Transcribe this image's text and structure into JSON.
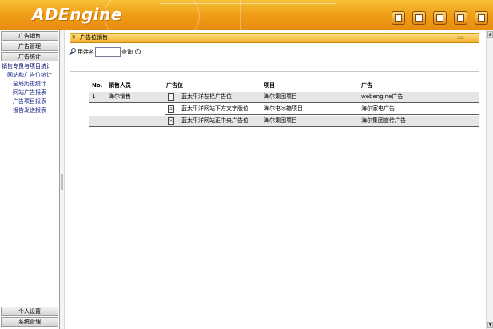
{
  "app": {
    "logo_text": "ADEngine"
  },
  "header_icons": [
    {
      "icon": "tools-icon"
    },
    {
      "icon": "window-icon"
    },
    {
      "icon": "monitor-icon"
    },
    {
      "icon": "edit-icon"
    },
    {
      "icon": "exit-icon"
    }
  ],
  "sidebar": {
    "sections": [
      {
        "label": "广告销售"
      },
      {
        "label": "广告管理"
      },
      {
        "label": "广告统计"
      }
    ],
    "links": [
      {
        "label": "销售专员与项目统计"
      },
      {
        "label": "网站和广告位统计"
      },
      {
        "label": "全局历史统计"
      },
      {
        "label": "网站广告报表"
      },
      {
        "label": "广告项目报表"
      },
      {
        "label": "报告发送报表"
      }
    ],
    "bottom_sections": [
      {
        "label": "个人设置"
      },
      {
        "label": "系统管理"
      }
    ]
  },
  "panel": {
    "title": "广告位销售",
    "dots": "::::::"
  },
  "search": {
    "label": "用姓名",
    "value": "",
    "button_label": "查询"
  },
  "table": {
    "headers": {
      "no": "No.",
      "person": "销售人员",
      "position": "广告位",
      "project": "项目",
      "ad": "广告"
    },
    "rows": [
      {
        "no": "1",
        "person": "海尔销售",
        "position_icon": "document-icon",
        "position": "蓝太平洋左栏广告位",
        "project": "海尔集团项目",
        "ad": "webengine广告"
      },
      {
        "no": "",
        "person": "",
        "position_icon": "text-ad-icon",
        "position": "蓝太平洋网站下方文字版位",
        "project": "海尔电冰箱项目",
        "ad": "海尔家电广告"
      },
      {
        "no": "",
        "person": "",
        "position_icon": "close-box-icon",
        "position": "蓝太平洋网站正中央广告位",
        "project": "海尔集团项目",
        "ad": "海尔集团宣传广告"
      }
    ]
  },
  "colors": {
    "header_orange": "#f0a018",
    "panel_title": "#f4ae2a",
    "link_blue": "#1a2a8a",
    "row_shade": "#e6e6e6"
  }
}
